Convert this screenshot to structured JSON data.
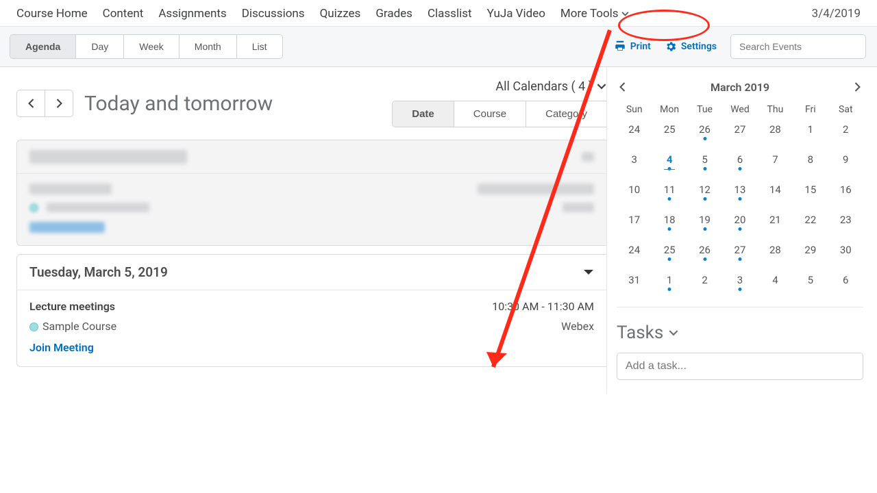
{
  "topnav": {
    "items": [
      "Course Home",
      "Content",
      "Assignments",
      "Discussions",
      "Quizzes",
      "Grades",
      "Classlist",
      "YuJa Video",
      "More Tools"
    ],
    "date": "3/4/2019"
  },
  "views": [
    "Agenda",
    "Day",
    "Week",
    "Month",
    "List"
  ],
  "toolbar": {
    "print": "Print",
    "settings": "Settings",
    "search_placeholder": "Search Events"
  },
  "page": {
    "title": "Today and tomorrow",
    "all_cal": "All Calendars ( 4 )"
  },
  "sorttabs": [
    "Date",
    "Course",
    "Category"
  ],
  "day2": {
    "header": "Tuesday, March 5, 2019",
    "event_title": "Lecture meetings",
    "time": "10:30 AM - 11:30 AM",
    "course": "Sample Course",
    "location": "Webex",
    "join": "Join Meeting"
  },
  "mini": {
    "month": "March 2019",
    "dow": [
      "Sun",
      "Mon",
      "Tue",
      "Wed",
      "Thu",
      "Fri",
      "Sat"
    ],
    "cells": [
      {
        "n": "24"
      },
      {
        "n": "25"
      },
      {
        "n": "26",
        "u": "blue"
      },
      {
        "n": "27"
      },
      {
        "n": "28"
      },
      {
        "n": "1"
      },
      {
        "n": "2"
      },
      {
        "n": "3"
      },
      {
        "n": "4",
        "today": true,
        "u": "blue"
      },
      {
        "n": "5",
        "u": "blue"
      },
      {
        "n": "6",
        "u": "blue"
      },
      {
        "n": "7"
      },
      {
        "n": "8"
      },
      {
        "n": "9"
      },
      {
        "n": "10"
      },
      {
        "n": "11",
        "u": "blue"
      },
      {
        "n": "12",
        "u": "blue"
      },
      {
        "n": "13",
        "u": "blue"
      },
      {
        "n": "14"
      },
      {
        "n": "15"
      },
      {
        "n": "16"
      },
      {
        "n": "17"
      },
      {
        "n": "18",
        "u": "blue"
      },
      {
        "n": "19",
        "u": "blue"
      },
      {
        "n": "20",
        "u": "blue"
      },
      {
        "n": "21"
      },
      {
        "n": "22"
      },
      {
        "n": "23"
      },
      {
        "n": "24"
      },
      {
        "n": "25",
        "u": "blue"
      },
      {
        "n": "26",
        "u": "blue"
      },
      {
        "n": "27",
        "u": "blue"
      },
      {
        "n": "28"
      },
      {
        "n": "29"
      },
      {
        "n": "30"
      },
      {
        "n": "31"
      },
      {
        "n": "1",
        "u": "blue"
      },
      {
        "n": "2"
      },
      {
        "n": "3",
        "u": "blue"
      },
      {
        "n": "4"
      },
      {
        "n": "5"
      },
      {
        "n": "6"
      }
    ]
  },
  "tasks": {
    "heading": "Tasks",
    "placeholder": "Add a task..."
  },
  "icons": {
    "chevron_down": "chevron-down-icon",
    "chevron_left": "chevron-left-icon",
    "chevron_right": "chevron-right-icon",
    "caret_down": "caret-down-icon",
    "print": "print-icon",
    "settings": "gear-icon",
    "search": "search-icon"
  }
}
